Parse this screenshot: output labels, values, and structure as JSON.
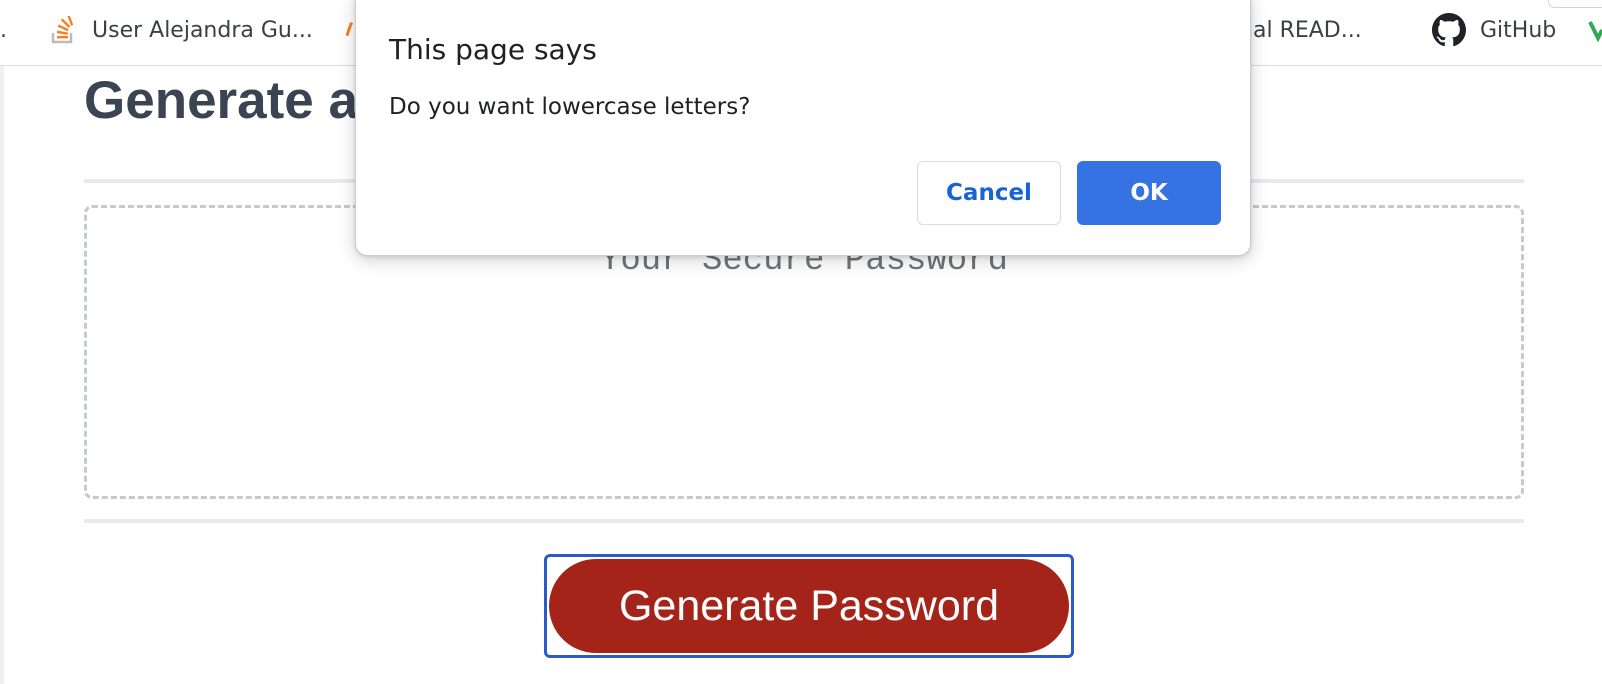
{
  "browser": {
    "bookmarks": [
      {
        "label": ".",
        "icon": "ellipsis-icon"
      },
      {
        "label": "User Alejandra Gu...",
        "icon": "stackoverflow-icon"
      },
      {
        "label": "sional READ...",
        "icon": ""
      },
      {
        "label": "GitHub",
        "icon": "github-icon"
      }
    ],
    "colors": {
      "stackoverflow": "#f48024",
      "github": "#1f2328",
      "peek_green": "#34a853"
    }
  },
  "page": {
    "title": "Generate a",
    "password_placeholder": "Your Secure Password",
    "generate_button": "Generate Password",
    "colors": {
      "button": "#a52419",
      "title": "#3a4452",
      "focus_ring": "#2a5bc7"
    }
  },
  "dialog": {
    "title": "This page says",
    "message": "Do you want lowercase letters?",
    "cancel_label": "Cancel",
    "ok_label": "OK",
    "colors": {
      "ok_bg": "#3573e3",
      "cancel_text": "#1a63d6"
    }
  }
}
